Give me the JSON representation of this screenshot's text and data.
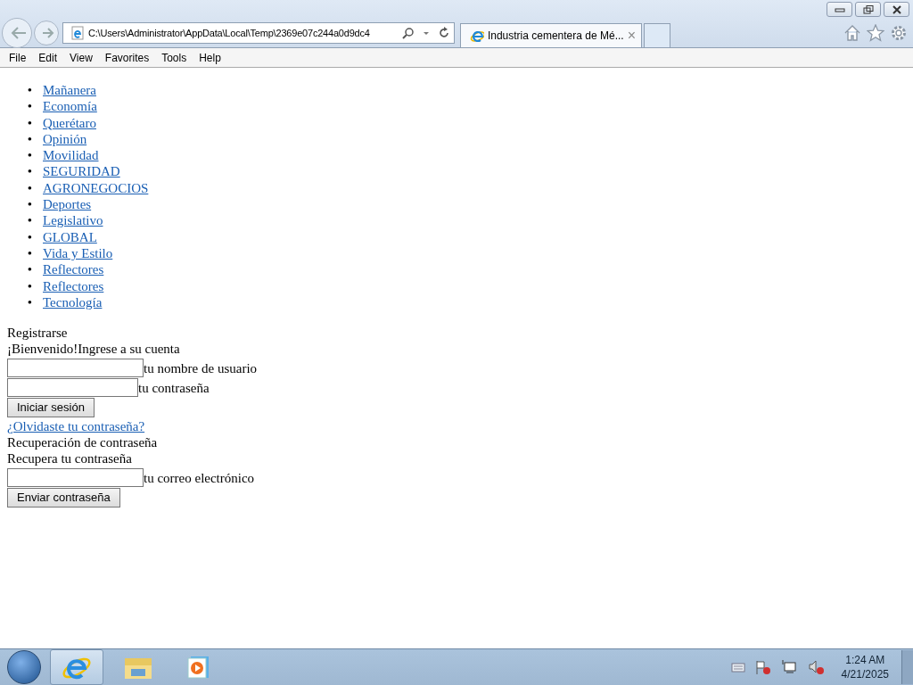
{
  "browser": {
    "address": "C:\\Users\\Administrator\\AppData\\Local\\Temp\\2369e07c244a0d9dc4",
    "tab": {
      "title": "Industria cementera de Mé...",
      "close": "×"
    },
    "menu": [
      "File",
      "Edit",
      "View",
      "Favorites",
      "Tools",
      "Help"
    ]
  },
  "nav": [
    {
      "marker": "•",
      "label": "Mañanera"
    },
    {
      "marker": "•",
      "label": "Economía"
    },
    {
      "marker": "•",
      "label": "Querétaro"
    },
    {
      "marker": "•",
      "label": "Opinión"
    },
    {
      "marker": "•",
      "label": "Movilidad"
    },
    {
      "marker": "•",
      "label": "SEGURIDAD"
    },
    {
      "marker": "•",
      "label": "AGRONEGOCIOS"
    },
    {
      "marker": "•",
      "label": "Deportes"
    },
    {
      "marker": "•",
      "label": "Legislativo"
    },
    {
      "marker": "•",
      "label": "GLOBAL"
    },
    {
      "marker": "•",
      "label": "Vida y Estilo"
    },
    {
      "marker": "•",
      "label": "Reflectores"
    },
    {
      "marker": "•",
      "label": "Reflectores"
    },
    {
      "marker": "•",
      "label": "Tecnología"
    }
  ],
  "login": {
    "register": "Registrarse",
    "welcome": "¡Bienvenido!Ingrese a su cuenta",
    "username_label": "tu nombre de usuario",
    "password_label": "tu contraseña",
    "submit": "Iniciar sesión",
    "forgot": "¿Olvidaste tu contraseña?"
  },
  "recovery": {
    "title": "Recuperación de contraseña",
    "subtitle": "Recupera tu contraseña",
    "email_label": "tu correo electrónico",
    "submit": "Enviar contraseña"
  },
  "taskbar": {
    "apps": [
      {
        "kind": "ie",
        "selected": true
      },
      {
        "kind": "explorer",
        "selected": false
      },
      {
        "kind": "media",
        "selected": false
      }
    ],
    "time": "1:24 AM",
    "date": "4/21/2025"
  }
}
